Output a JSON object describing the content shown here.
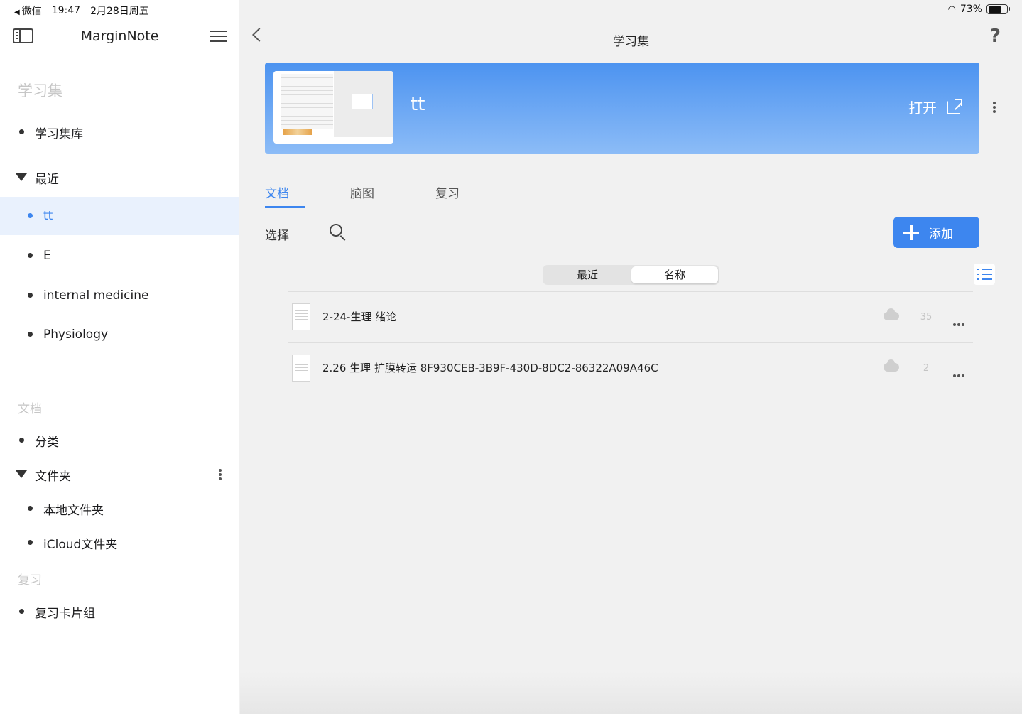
{
  "status_bar": {
    "back_app": "微信",
    "time": "19:47",
    "date": "2月28日周五",
    "battery": "73%",
    "battery_level": 0.73
  },
  "sidebar": {
    "app_title": "MarginNote",
    "sections": {
      "study_sets": "学习集",
      "documents": "文档",
      "review": "复习"
    },
    "items": {
      "library": "学习集库",
      "recent": "最近",
      "recent_tt": "tt",
      "recent_e": "E",
      "recent_internal": "internal medicine",
      "recent_physiology": "Physiology",
      "categories": "分类",
      "folders": "文件夹",
      "local_folder": "本地文件夹",
      "icloud_folder": "iCloud文件夹",
      "card_groups": "复习卡片组"
    }
  },
  "header": {
    "title": "学习集",
    "help": "?"
  },
  "hero": {
    "title": "tt",
    "open_label": "打开"
  },
  "tabs": [
    "文档",
    "脑图",
    "复习"
  ],
  "toolbar": {
    "select_label": "选择",
    "add_label": "添加"
  },
  "sort": {
    "recent": "最近",
    "name": "名称",
    "selected": "名称"
  },
  "documents": [
    {
      "name": "2-24-生理 绪论",
      "count": "35"
    },
    {
      "name": "2.26 生理 扩膜转运 8F930CEB-3B9F-430D-8DC2-86322A09A46C",
      "count": "2"
    }
  ],
  "colors": {
    "accent": "#3d86ef",
    "hero_top": "#4c93f0",
    "hero_bottom": "#8cbcf7",
    "active_row": "#e9f1fd"
  }
}
